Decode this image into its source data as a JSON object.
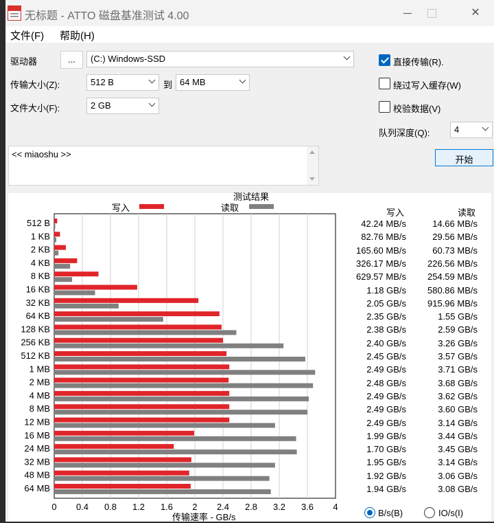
{
  "window": {
    "title": "无标题 - ATTO 磁盘基准测试 4.00"
  },
  "menu": {
    "file": "文件(F)",
    "help": "帮助(H)"
  },
  "drive": {
    "label": "驱动器",
    "browse": "...",
    "value": "(C:) Windows-SSD"
  },
  "transfer": {
    "label": "传输大小(Z):",
    "from": "512 B",
    "to_label": "到",
    "to": "64 MB"
  },
  "filesize": {
    "label": "文件大小(F):",
    "value": "2 GB"
  },
  "options": {
    "direct": {
      "label": "直接传输(R).",
      "checked": true
    },
    "bypass": {
      "label": "绕过写入缓存(W)",
      "checked": false
    },
    "verify": {
      "label": "校验数据(V)",
      "checked": false
    },
    "queue_label": "队列深度(Q):",
    "queue_value": "4"
  },
  "start_button": "开始",
  "description": "<< miaoshu >>",
  "results": {
    "title": "测试结果",
    "write_legend": "写入",
    "read_legend": "读取",
    "write_header": "写入",
    "read_header": "读取",
    "x_axis_label": "传输速率 - GB/s",
    "units": {
      "bs": "B/s(B)",
      "ios": "IO/s(I)",
      "selected": "bs"
    }
  },
  "colors": {
    "write": "#e0252a",
    "read": "#808080"
  },
  "chart_data": {
    "type": "bar",
    "orientation": "horizontal",
    "title": "测试结果",
    "xlabel": "传输速率 - GB/s",
    "xlim": [
      0,
      4
    ],
    "xticks": [
      "0",
      "0.4",
      "0.8",
      "1.2",
      "1.6",
      "2",
      "2.4",
      "2.8",
      "3.2",
      "3.6",
      "4"
    ],
    "categories": [
      "512 B",
      "1 KB",
      "2 KB",
      "4 KB",
      "8 KB",
      "16 KB",
      "32 KB",
      "64 KB",
      "128 KB",
      "256 KB",
      "512 KB",
      "1 MB",
      "2 MB",
      "4 MB",
      "8 MB",
      "12 MB",
      "16 MB",
      "24 MB",
      "32 MB",
      "48 MB",
      "64 MB"
    ],
    "series": [
      {
        "name": "写入",
        "values": [
          0.04224,
          0.08276,
          0.1656,
          0.32617,
          0.62957,
          1.18,
          2.05,
          2.35,
          2.38,
          2.4,
          2.45,
          2.49,
          2.48,
          2.49,
          2.49,
          2.49,
          1.99,
          1.7,
          1.95,
          1.92,
          1.94
        ],
        "labels": [
          "42.24 MB/s",
          "82.76 MB/s",
          "165.60 MB/s",
          "326.17 MB/s",
          "629.57 MB/s",
          "1.18 GB/s",
          "2.05 GB/s",
          "2.35 GB/s",
          "2.38 GB/s",
          "2.40 GB/s",
          "2.45 GB/s",
          "2.49 GB/s",
          "2.48 GB/s",
          "2.49 GB/s",
          "2.49 GB/s",
          "2.49 GB/s",
          "1.99 GB/s",
          "1.70 GB/s",
          "1.95 GB/s",
          "1.92 GB/s",
          "1.94 GB/s"
        ]
      },
      {
        "name": "读取",
        "values": [
          0.01466,
          0.02956,
          0.06073,
          0.22656,
          0.25459,
          0.58086,
          0.91596,
          1.55,
          2.59,
          3.26,
          3.57,
          3.71,
          3.68,
          3.62,
          3.6,
          3.14,
          3.44,
          3.45,
          3.14,
          3.06,
          3.08
        ],
        "labels": [
          "14.66 MB/s",
          "29.56 MB/s",
          "60.73 MB/s",
          "226.56 MB/s",
          "254.59 MB/s",
          "580.86 MB/s",
          "915.96 MB/s",
          "1.55 GB/s",
          "2.59 GB/s",
          "3.26 GB/s",
          "3.57 GB/s",
          "3.71 GB/s",
          "3.68 GB/s",
          "3.62 GB/s",
          "3.60 GB/s",
          "3.14 GB/s",
          "3.44 GB/s",
          "3.45 GB/s",
          "3.14 GB/s",
          "3.06 GB/s",
          "3.08 GB/s"
        ]
      }
    ],
    "grid": true
  }
}
